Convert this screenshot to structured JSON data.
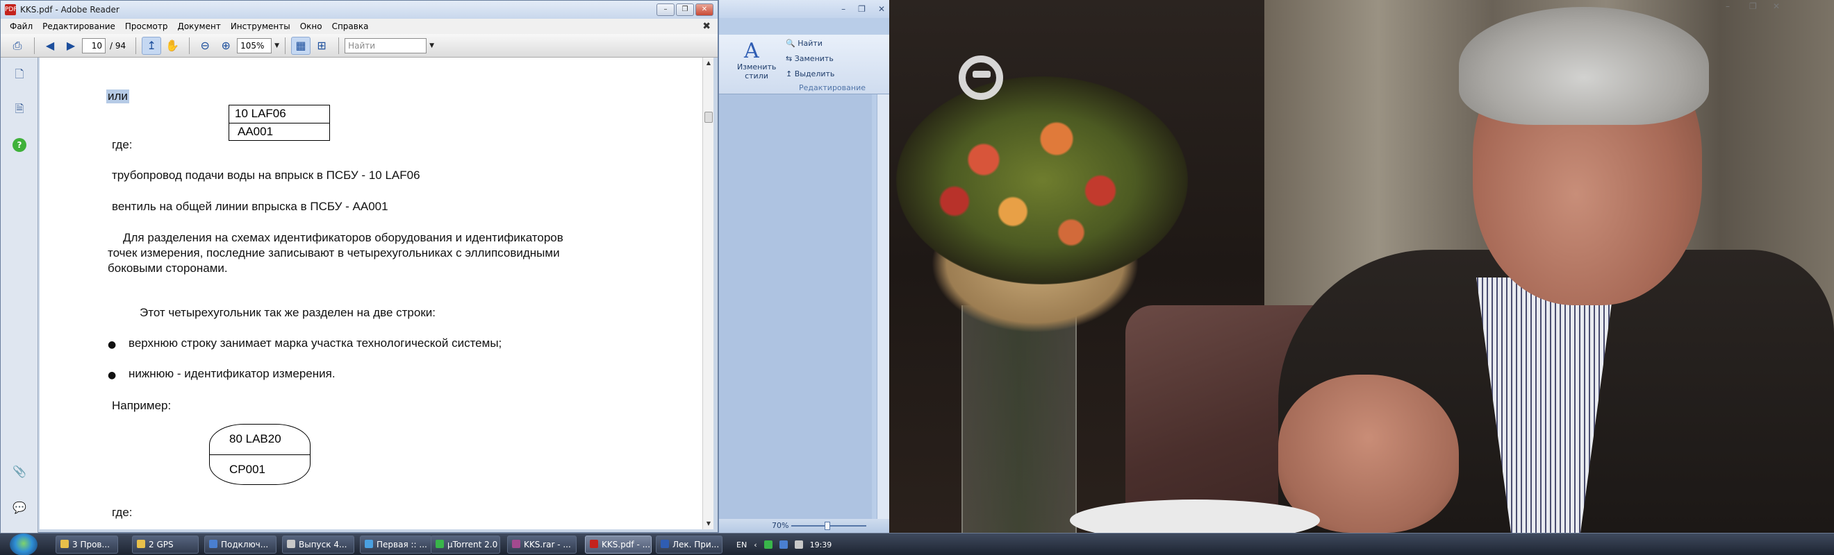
{
  "adobe_reader": {
    "window_title": "KKS.pdf - Adobe Reader",
    "title_icon": "PDF",
    "menu": [
      "Файл",
      "Редактирование",
      "Просмотр",
      "Документ",
      "Инструменты",
      "Окно",
      "Справка"
    ],
    "toolbar": {
      "page_current": "10",
      "page_total": "/ 94",
      "zoom": "105%",
      "search_placeholder": "Найти"
    },
    "document": {
      "ili": "или",
      "box1": [
        "10 LAF06",
        "AA001"
      ],
      "gde1": "где:",
      "line1": "трубопровод подачи воды на впрыск в ПСБУ - 10 LAF06",
      "line2": "вентиль на общей линии впрыска в ПСБУ - АА001",
      "para1": [
        "Для разделения на схемах идентификаторов оборудования и идентификаторов",
        "точек измерения, последние записывают в четырехугольниках с эллипсовидными",
        "боковыми сторонами."
      ],
      "para2": "Этот четырехугольник так же разделен на две строки:",
      "bullet1": "верхнюю строку занимает марка участка технологической системы;",
      "bullet2": "нижнюю - идентификатор измерения.",
      "example": "Например:",
      "box2": [
        "80 LAB20",
        "CP001"
      ],
      "gde2": "где:"
    }
  },
  "word": {
    "styles_label": "Изменить стили",
    "find": "Найти",
    "replace": "Заменить",
    "select": "Выделить",
    "group": "Редактирование",
    "zoom": "70%"
  },
  "taskbar": {
    "tasks": [
      {
        "label": "3 Пров...",
        "color": "#e8c04a"
      },
      {
        "label": "2 GPS",
        "color": "#e8c04a"
      },
      {
        "label": "Подключ...",
        "color": "#4a7fd0"
      },
      {
        "label": "Выпуск 4...",
        "color": "#c8c8c8"
      },
      {
        "label": "Первая :: ...",
        "color": "#4aa0e0"
      },
      {
        "label": "µTorrent 2.0",
        "color": "#39b54a"
      },
      {
        "label": "KKS.rar - ...",
        "color": "#a34a8f"
      },
      {
        "label": "KKS.pdf - ...",
        "color": "#c4221c"
      },
      {
        "label": "Лек. При...",
        "color": "#2f5db3"
      }
    ],
    "language": "EN",
    "clock": "19:39"
  }
}
